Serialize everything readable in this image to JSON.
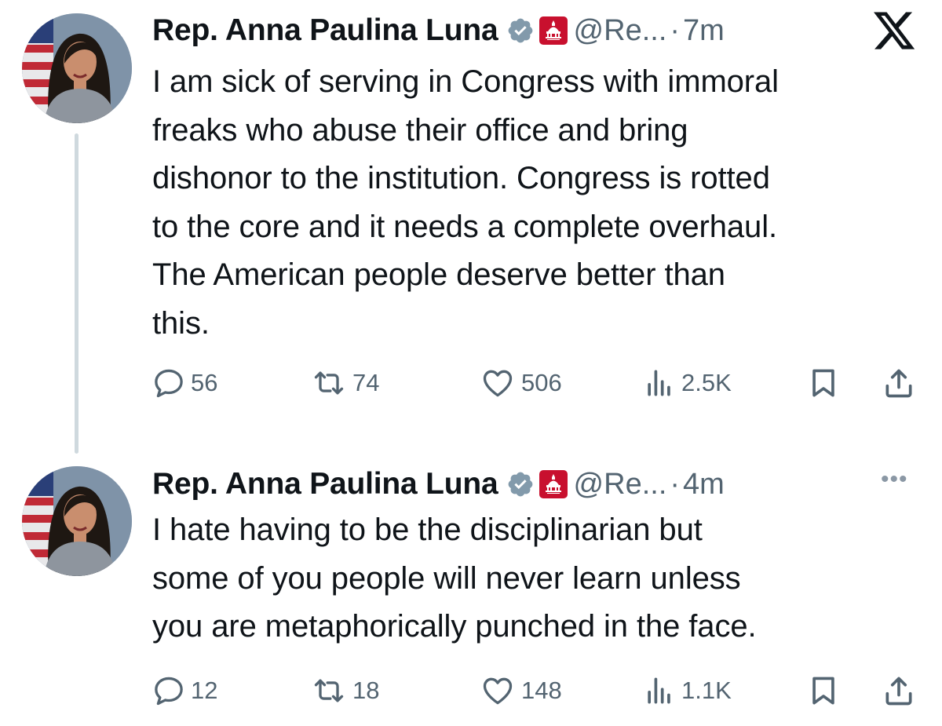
{
  "tweets": [
    {
      "author_name": "Rep. Anna Paulina Luna",
      "handle": "@Re...",
      "separator": "·",
      "time": "7m",
      "lines": [
        "I am sick of serving in Congress with immoral",
        "freaks who abuse their office and bring",
        "dishonor to the institution. Congress is rotted",
        "to the core and it needs a complete overhaul.",
        "The American people deserve better than",
        "this."
      ],
      "replies": "56",
      "reposts": "74",
      "likes": "506",
      "views": "2.5K",
      "corner_icon": "x-logo-icon"
    },
    {
      "author_name": "Rep. Anna Paulina Luna",
      "handle": "@Re...",
      "separator": "·",
      "time": "4m",
      "lines": [
        "I hate having to be the disciplinarian but",
        "some of you people will never learn unless",
        "you are metaphorically punched in the face."
      ],
      "replies": "12",
      "reposts": "18",
      "likes": "148",
      "views": "1.1K",
      "corner_icon": "more-options-icon",
      "more_glyph": "•••"
    }
  ],
  "colors": {
    "text": "#0f1419",
    "muted": "#536471",
    "verified_badge": "#829aab",
    "gop_badge": "#c8102e",
    "thread_line": "#cfd9de"
  }
}
